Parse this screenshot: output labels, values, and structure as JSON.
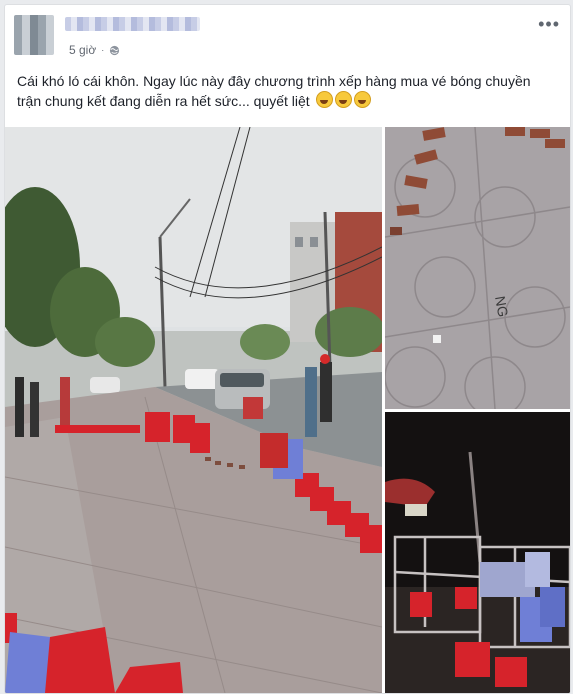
{
  "post": {
    "author_name": "",
    "timestamp": "5 giờ",
    "separator": "·",
    "privacy_icon": "globe-icon",
    "more_icon": "more-options-icon",
    "text": "Cái khó ló cái khôn. Ngay lúc này đây chương trình xếp hàng mua vé bóng chuyền trận chung kết đang diễn ra hết sức... quyết liệt",
    "emoji_count": 3
  },
  "photos": [
    {
      "scene": "street-queue-chairs"
    },
    {
      "scene": "bricks-on-pavement"
    },
    {
      "scene": "night-cages-chairs"
    }
  ],
  "colors": {
    "card_bg": "#ffffff",
    "page_bg": "#e9ebee",
    "text": "#1d2129",
    "meta": "#616770",
    "chair_red": "#d6232b",
    "chair_blue": "#6f7fd6"
  }
}
